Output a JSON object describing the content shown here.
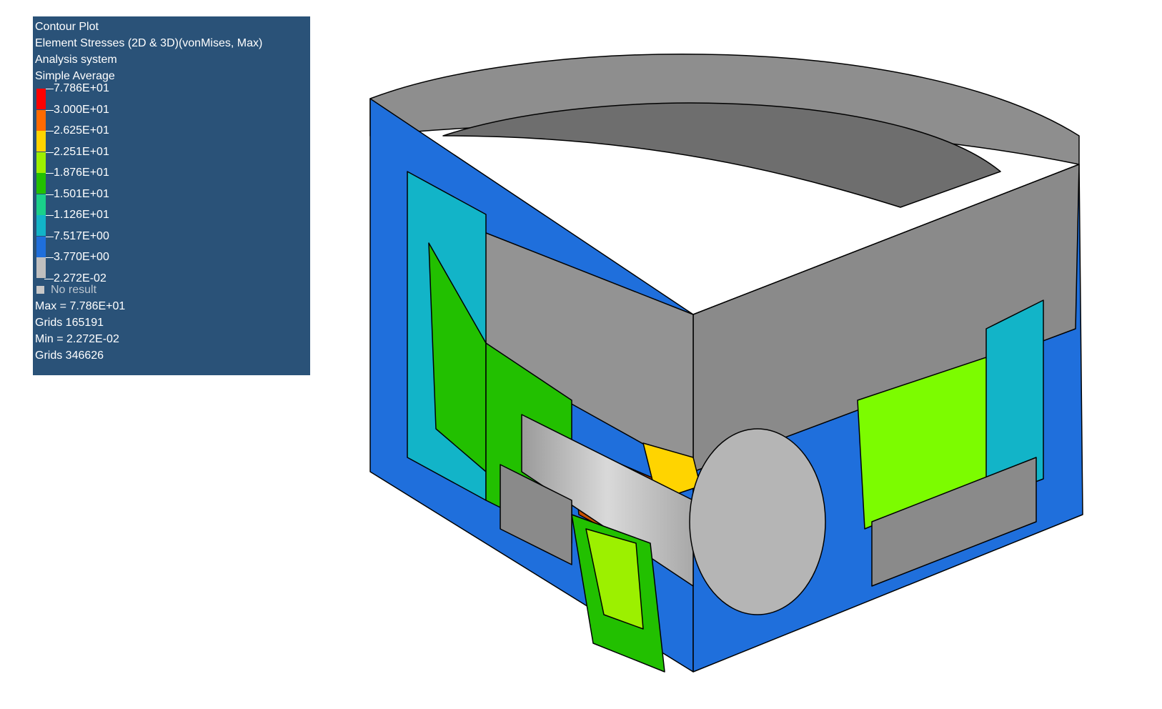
{
  "legend": {
    "header_lines": [
      "Contour Plot",
      "Element Stresses (2D & 3D)(vonMises, Max)",
      "Analysis system",
      "Simple Average"
    ],
    "levels": [
      "7.786E+01",
      "3.000E+01",
      "2.625E+01",
      "2.251E+01",
      "1.876E+01",
      "1.501E+01",
      "1.126E+01",
      "7.517E+00",
      "3.770E+00",
      "2.272E-02"
    ],
    "band_colors": [
      "#ff0000",
      "#ff6a00",
      "#ffd400",
      "#9cf000",
      "#22c000",
      "#1ad08a",
      "#12b4c8",
      "#1f6fdc",
      "#bfbfbf"
    ],
    "no_result_label": "No result",
    "max_text": "Max = 7.786E+01",
    "max_grid_text": "Grids 165191",
    "min_text": "Min = 2.272E-02",
    "min_grid_text": "Grids 346626"
  },
  "colors": {
    "legend_background": "#2a5278",
    "model_gray": "#8c8c8c",
    "model_top": "#7a7a7a"
  }
}
